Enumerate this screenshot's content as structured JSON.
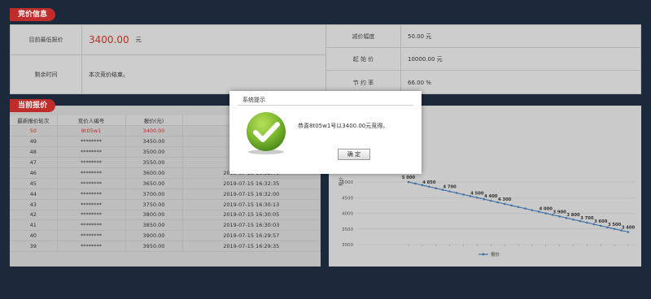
{
  "bid_info": {
    "tag": "竞价信息",
    "current_lowest_label": "目前最低报价",
    "current_lowest_value": "3400.00",
    "currency_unit": "元",
    "remaining_time_label": "剩余时间",
    "remaining_time_value": "本次竞价结束。",
    "decrement_label": "减价幅度",
    "decrement_value": "50.00 元",
    "start_price_label": "起 始 价",
    "start_price_value": "10000.00 元",
    "savings_rate_label": "节 约 率",
    "savings_rate_value": "66.00 %"
  },
  "current_bids": {
    "tag": "当前报价",
    "headers": [
      "最新报价轮次",
      "竞价人编号",
      "报价(元)",
      ""
    ],
    "rows": [
      [
        "50",
        "8t05w1",
        "3400.00",
        "20"
      ],
      [
        "49",
        "********",
        "3450.00",
        "20"
      ],
      [
        "48",
        "********",
        "3500.00",
        "20"
      ],
      [
        "47",
        "********",
        "3550.00",
        "20"
      ],
      [
        "46",
        "********",
        "3600.00",
        "2019-07-15 16:32:46"
      ],
      [
        "45",
        "********",
        "3650.00",
        "2019-07-15 16:32:35"
      ],
      [
        "44",
        "********",
        "3700.00",
        "2019-07-15 16:32:00"
      ],
      [
        "43",
        "********",
        "3750.00",
        "2019-07-15 16:30:13"
      ],
      [
        "42",
        "********",
        "3800.00",
        "2019-07-15 16:30:05"
      ],
      [
        "41",
        "********",
        "3850.00",
        "2019-07-15 16:30:03"
      ],
      [
        "40",
        "********",
        "3900.00",
        "2019-07-15 16:29:57"
      ],
      [
        "39",
        "********",
        "3950.00",
        "2019-07-15 16:29:35"
      ]
    ]
  },
  "dialog": {
    "title": "系统提示",
    "message": "恭喜8t05w1号以3400.00元竞得。",
    "ok_label": "确 定",
    "icon": "check-icon"
  },
  "chart_data": {
    "type": "line",
    "ylabel": "报价",
    "yticks": [
      "5000",
      "4500",
      "4000",
      "3500",
      "3000"
    ],
    "ylim": [
      3000,
      5000
    ],
    "values": [
      5000,
      4950,
      4900,
      4850,
      4800,
      4750,
      4700,
      4650,
      4600,
      4550,
      4500,
      4450,
      4400,
      4350,
      4300,
      4250,
      4200,
      4150,
      4100,
      4050,
      4000,
      3950,
      3900,
      3850,
      3800,
      3750,
      3700,
      3650,
      3600,
      3550,
      3500,
      3450,
      3400
    ],
    "data_labels": [
      "5 000",
      "4 850",
      "4 700",
      "4 500",
      "4 400",
      "4 300",
      "4 000",
      "3 900",
      "3 800",
      "3 700",
      "3 600",
      "3 500",
      "3 400"
    ],
    "data_label_values": [
      5000,
      4850,
      4700,
      4500,
      4400,
      4300,
      4000,
      3900,
      3800,
      3700,
      3600,
      3500,
      3400
    ],
    "legend": [
      "报价"
    ],
    "legend_position": "bottom-center",
    "colors": {
      "line": "#4a7bb0"
    }
  }
}
